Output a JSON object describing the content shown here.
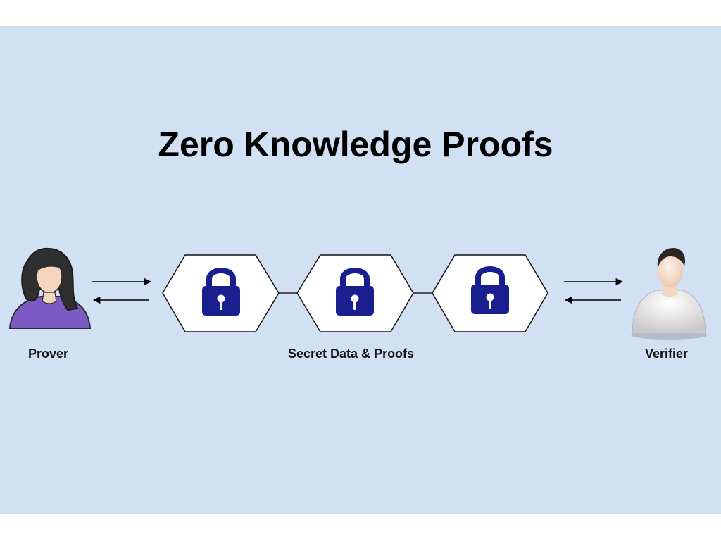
{
  "title": "Zero Knowledge Proofs",
  "labels": {
    "prover": "Prover",
    "center": "Secret Data & Proofs",
    "verifier": "Verifier"
  },
  "colors": {
    "background": "#d2e0f3",
    "lock": "#1a1f8f",
    "prover_shirt": "#7c5cc4",
    "skin": "#f5d5bd"
  },
  "nodes": [
    {
      "icon": "padlock-icon"
    },
    {
      "icon": "padlock-icon"
    },
    {
      "icon": "padlock-icon"
    }
  ]
}
